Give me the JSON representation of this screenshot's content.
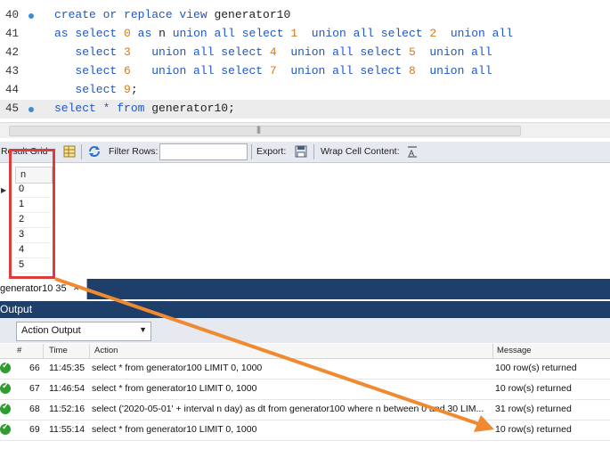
{
  "editor": {
    "lines": [
      {
        "number": "40",
        "has_marker": true
      },
      {
        "number": "41",
        "has_marker": false
      },
      {
        "number": "42",
        "has_marker": false
      },
      {
        "number": "43",
        "has_marker": false
      },
      {
        "number": "44",
        "has_marker": false
      },
      {
        "number": "45",
        "has_marker": true
      }
    ],
    "tokens": {
      "l40_kw": "create or replace view",
      "l40_id": "generator10",
      "l41_as": "as select",
      "l41_n0": "0",
      "l41_as2": "as",
      "l41_n": "n",
      "l41_kw": "union all select",
      "l41_n1": "1",
      "l41_kw2": "union all select",
      "l41_n2": "2",
      "l41_kw3": "union all",
      "l42_sel": "select",
      "l42_n3": "3",
      "l42_kw": "union all select",
      "l42_n4": "4",
      "l42_kw2": "union all select",
      "l42_n5": "5",
      "l42_kw3": "union all",
      "l43_sel": "select",
      "l43_n6": "6",
      "l43_kw": "union all select",
      "l43_n7": "7",
      "l43_kw2": "union all select",
      "l43_n8": "8",
      "l43_kw3": "union all",
      "l44_sel": "select",
      "l44_n9": "9",
      "l44_semi": ";",
      "l45_kw": "select * from",
      "l45_id": "generator10",
      "l45_semi": ";"
    }
  },
  "result_toolbar": {
    "result_grid_label": "Result Grid",
    "filter_rows_label": "Filter Rows:",
    "filter_value": "",
    "export_label": "Export:",
    "wrap_label": "Wrap Cell Content:"
  },
  "grid": {
    "column": "n",
    "rows": [
      "0",
      "1",
      "2",
      "3",
      "4",
      "5"
    ]
  },
  "tab": {
    "label": "generator10 35",
    "close": "×"
  },
  "output": {
    "title": "Output",
    "selector_value": "Action Output",
    "columns": {
      "num": "#",
      "time": "Time",
      "action": "Action",
      "message": "Message"
    },
    "rows": [
      {
        "num": "66",
        "time": "11:45:35",
        "action": "select * from generator100 LIMIT 0, 1000",
        "message": "100 row(s) returned"
      },
      {
        "num": "67",
        "time": "11:46:54",
        "action": "select * from generator10 LIMIT 0, 1000",
        "message": "10 row(s) returned"
      },
      {
        "num": "68",
        "time": "11:52:16",
        "action": "select ('2020-05-01' + interval n day) as dt from generator100 where n between 0 and 30 LIM...",
        "message": "31 row(s) returned"
      },
      {
        "num": "69",
        "time": "11:55:14",
        "action": "select * from generator10 LIMIT 0, 1000",
        "message": "10 row(s) returned"
      }
    ]
  },
  "colors": {
    "annotation_red": "#e03b3b",
    "annotation_orange": "#f08a30",
    "panel_navy": "#1d3f6a",
    "keyword_blue": "#1f56c9",
    "number_orange": "#d47a1c"
  }
}
